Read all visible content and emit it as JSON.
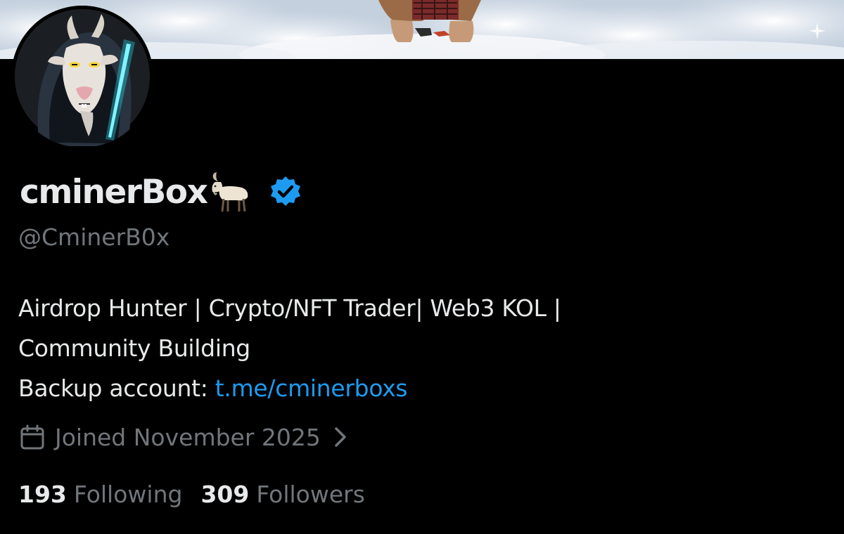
{
  "profile": {
    "display_name": "cminerBox",
    "name_emoji": "goat-emoji",
    "verified_badge": "verified-badge-icon",
    "handle": "@CminerB0x",
    "bio": {
      "line1": "Airdrop Hunter | Crypto/NFT Trader| Web3 KOL |",
      "line2": "Community Building",
      "line3_prefix": "Backup account: ",
      "link_text": "t.me/cminerboxs"
    },
    "joined": "Joined November 2025",
    "stats": {
      "following_count": "193",
      "following_label": "Following",
      "followers_count": "309",
      "followers_label": "Followers"
    }
  },
  "icons": {
    "calendar": "calendar-icon",
    "chevron": "chevron-right-icon",
    "sparkle": "sparkle-icon"
  },
  "colors": {
    "background": "#000000",
    "primary_text": "#e7e9ea",
    "secondary_text": "#71767b",
    "link": "#1d9bf0",
    "verified": "#1d9bf0"
  }
}
